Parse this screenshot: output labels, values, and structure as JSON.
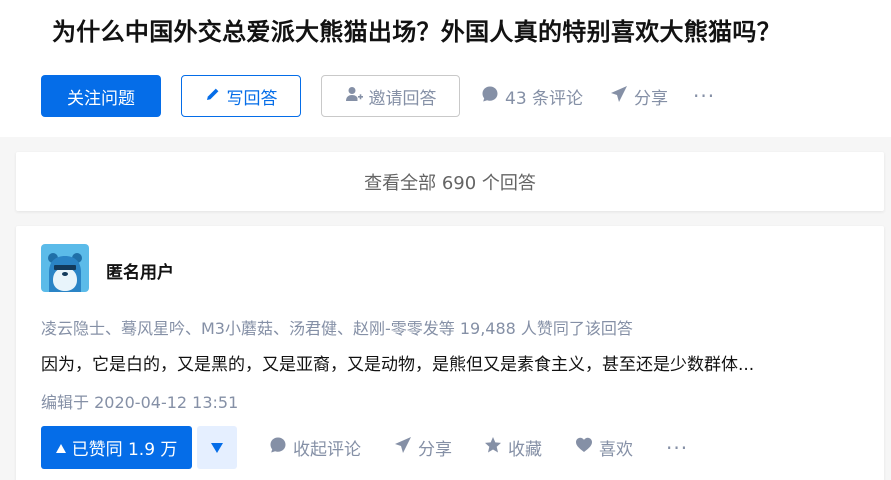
{
  "question": {
    "title": "为什么中国外交总爱派大熊猫出场？外国人真的特别喜欢大熊猫吗？",
    "follow_label": "关注问题",
    "write_label": "写回答",
    "invite_label": "邀请回答",
    "comments_label": "43 条评论",
    "share_label": "分享",
    "more_label": "···"
  },
  "view_all": {
    "label": "查看全部 690 个回答"
  },
  "answer": {
    "author_name": "匿名用户",
    "voters_text": "凌云隐士、蓦风星吟、M3小蘑菇、汤君健、赵刚-零零发等 19,488 人赞同了该回答",
    "excerpt": "因为，它是白的，又是黑的，又是亚裔，又是动物，是熊但又是素食主义，甚至还是少数群体...",
    "edited": "编辑于 2020-04-12 13:51",
    "vote_up_label": "已赞同 1.9 万",
    "collapse_comments_label": "收起评论",
    "share_label": "分享",
    "favorite_label": "收藏",
    "like_label": "喜欢",
    "more_label": "···"
  },
  "colors": {
    "brand_blue": "#056de8",
    "muted": "#8590a6",
    "vote_down_bg": "#e5efff",
    "avatar_bg": "#5bbbe9"
  },
  "icons": [
    "pencil-icon",
    "add-person-icon",
    "comment-bubble-icon",
    "paper-plane-icon",
    "triangle-up-icon",
    "triangle-down-icon",
    "star-icon",
    "heart-icon",
    "anonymous-avatar"
  ]
}
